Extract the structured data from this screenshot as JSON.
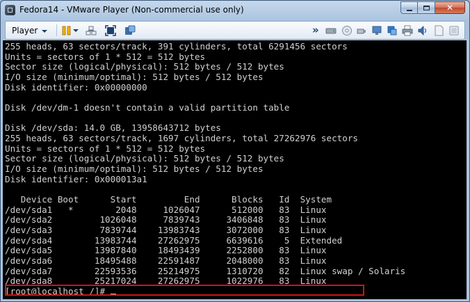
{
  "window": {
    "title": "Fedora14 - VMware Player (Non-commercial use only)",
    "close_symbol": "✕"
  },
  "toolbar": {
    "player_menu_label": "Player",
    "overflow_symbol": "»",
    "left_icons": [
      "pause-icon",
      "send-ctrl-alt-del-icon",
      "fullscreen-icon",
      "unity-icon"
    ],
    "device_icons": [
      "hard-disk-icon",
      "cd-dvd-icon",
      "usb-icon",
      "network-adapter-icon",
      "usb-device-icon",
      "printer-icon",
      "sound-card-icon",
      "message-log-icon"
    ]
  },
  "terminal": {
    "lines": [
      "255 heads, 63 sectors/track, 391 cylinders, total 6291456 sectors",
      "Units = sectors of 1 * 512 = 512 bytes",
      "Sector size (logical/physical): 512 bytes / 512 bytes",
      "I/O size (minimum/optimal): 512 bytes / 512 bytes",
      "Disk identifier: 0x00000000",
      "",
      "Disk /dev/dm-1 doesn't contain a valid partition table",
      "",
      "Disk /dev/sda: 14.0 GB, 13958643712 bytes",
      "255 heads, 63 sectors/track, 1697 cylinders, total 27262976 sectors",
      "Units = sectors of 1 * 512 = 512 bytes",
      "Sector size (logical/physical): 512 bytes / 512 bytes",
      "I/O size (minimum/optimal): 512 bytes / 512 bytes",
      "Disk identifier: 0x000013a1",
      "",
      "   Device Boot      Start         End      Blocks   Id  System",
      "/dev/sda1   *        2048     1026047      512000   83  Linux",
      "/dev/sda2         1026048     7839743     3406848   83  Linux",
      "/dev/sda3         7839744    13983743     3072000   83  Linux",
      "/dev/sda4        13983744    27262975     6639616    5  Extended",
      "/dev/sda5        13987840    18493439     2252800   83  Linux",
      "/dev/sda6        18495488    22591487     2048000   83  Linux",
      "/dev/sda7        22593536    25214975     1310720   82  Linux swap / Solaris",
      "/dev/sda8        25217024    27262975     1022976   83  Linux"
    ],
    "prompt": "[root@localhost /]# ",
    "highlighted_partition": "/dev/sda5",
    "highlight_color": "#d01414",
    "text_color": "#d0d0d0",
    "background_color": "#000000"
  }
}
